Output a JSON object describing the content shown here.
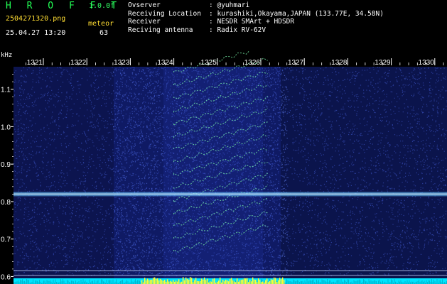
{
  "header": {
    "title": "H R O F F T",
    "version": "1.0.0f",
    "filename": "2504271320.png",
    "meteor_label": "meteor",
    "datetime": "25.04.27 13:20",
    "count": "63"
  },
  "station_info": [
    {
      "label": "Ovserver",
      "value": ": @yuhmari"
    },
    {
      "label": "Receiving Location",
      "value": ": kurashiki,Okayama,JAPAN (133.77E, 34.58N)"
    },
    {
      "label": "Receiver",
      "value": ": NESDR SMArt + HDSDR"
    },
    {
      "label": "Reciving antenna",
      "value": ": Radix RV-62V"
    }
  ],
  "colors": {
    "title": "#22ff55",
    "version": "#33ff66",
    "filename": "#ffdd33",
    "meteor_label": "#ffdd33",
    "datetime": "#ffffff",
    "count": "#ffffff",
    "info_text": "#ffffff",
    "freq_tick": "#ffffff",
    "khz_label": "#ffffff",
    "background": "#000000",
    "spectrogram_base": "#1b2fa8",
    "carrier_line": "#6ec8ff",
    "meteor_echo": "#7fffb0",
    "bottom_strip": "#00e5ff",
    "bottom_peak": "#ffff33"
  },
  "chart_data": {
    "type": "heatmap",
    "khz_label": "kHz",
    "x_ticks": [
      "1321",
      "1322",
      "1323",
      "1324",
      "1325",
      "1326",
      "1327",
      "1328",
      "1329",
      "1330"
    ],
    "y_ticks": [
      "1.1",
      "1.0",
      "0.9",
      "0.8",
      "0.7",
      "0.6"
    ],
    "y_range_khz": [
      0.58,
      1.16
    ],
    "x_range_tick": [
      1320.6,
      1330.3
    ],
    "carrier_khz": 0.82,
    "reference_lines_khz": [
      0.615,
      0.603
    ],
    "echo_band_seconds": [
      1324.0,
      1326.2
    ],
    "high_activity_band_seconds": [
      1322.6,
      1326.6
    ],
    "grid": false
  }
}
